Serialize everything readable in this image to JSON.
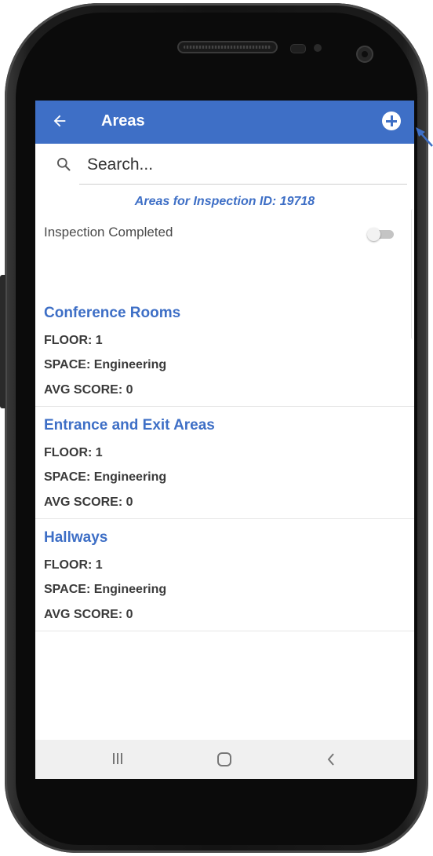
{
  "header": {
    "title": "Areas",
    "back_icon": "arrow-left-icon",
    "add_icon": "plus-circle-icon"
  },
  "search": {
    "placeholder": "Search...",
    "value": ""
  },
  "heading": "Areas for Inspection ID: 19718",
  "inspection_completed": {
    "label": "Inspection Completed",
    "toggle_on": false
  },
  "areas": [
    {
      "name": "Conference Rooms",
      "floor": "FLOOR: 1",
      "space": "SPACE: Engineering",
      "avg_score": "AVG SCORE: 0"
    },
    {
      "name": "Entrance and Exit Areas",
      "floor": "FLOOR: 1",
      "space": "SPACE: Engineering",
      "avg_score": "AVG SCORE: 0"
    },
    {
      "name": "Hallways",
      "floor": "FLOOR: 1",
      "space": "SPACE: Engineering",
      "avg_score": "AVG SCORE: 0"
    }
  ],
  "navbar": {
    "recents_icon": "recent-apps-icon",
    "home_icon": "home-icon",
    "back_icon": "system-back-icon"
  },
  "colors": {
    "primary": "#3e6fc6",
    "navbar_bg": "#f0f0f0",
    "text_dark": "#3a3a3a"
  }
}
